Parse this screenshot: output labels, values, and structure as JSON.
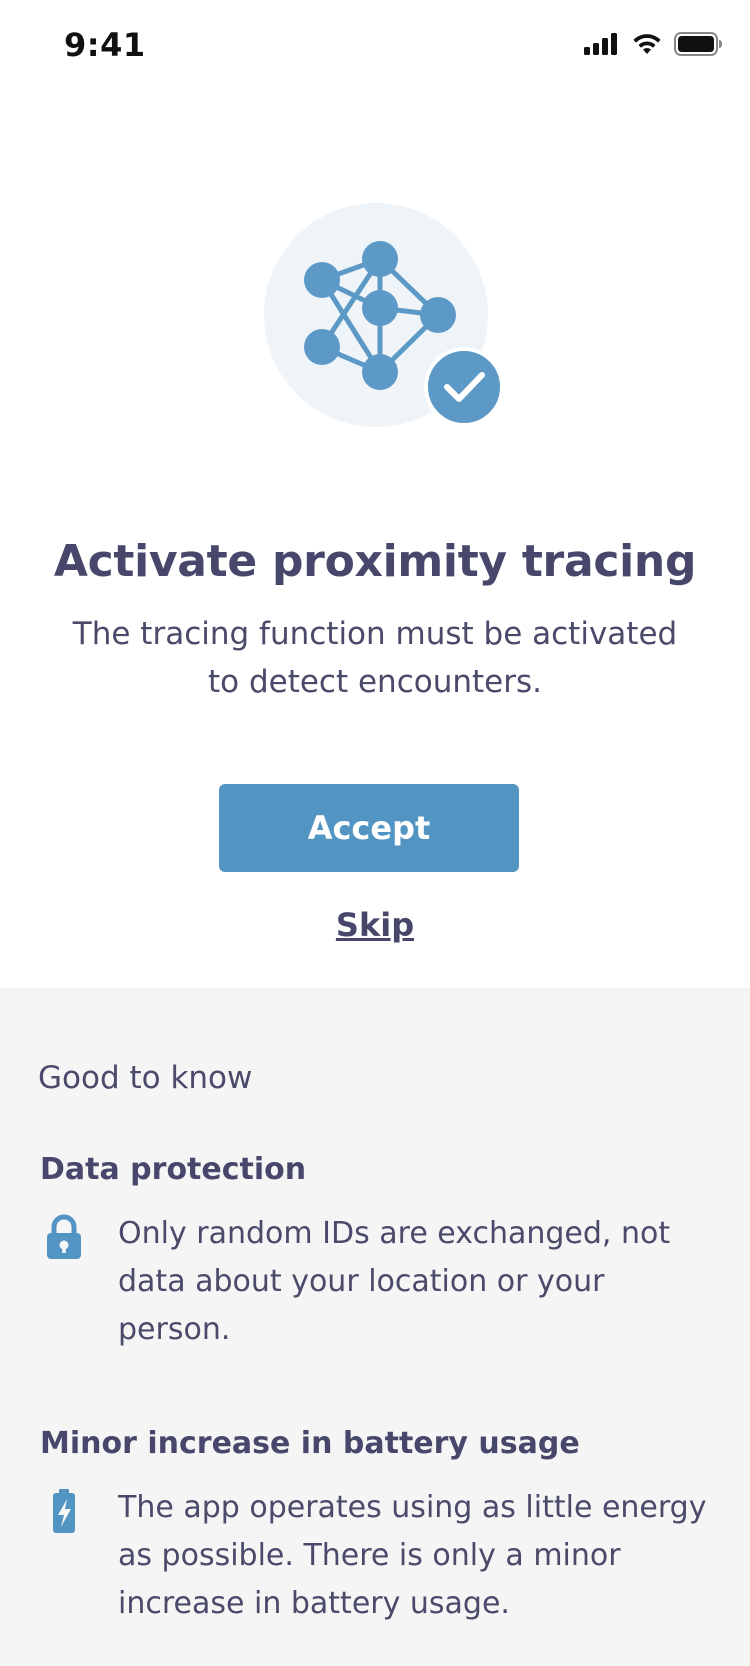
{
  "status_bar": {
    "time": "9:41",
    "icons": [
      "signal-icon",
      "wifi-icon",
      "battery-icon"
    ]
  },
  "hero": {
    "illustration": "network-check-illustration",
    "title": "Activate proximity tracing",
    "subtitle": "The tracing function must be activated to detect encounters.",
    "accept_label": "Accept",
    "skip_label": "Skip"
  },
  "info": {
    "heading": "Good to know",
    "items": [
      {
        "title": "Data protection",
        "icon": "lock-icon",
        "text": "Only random IDs are exchanged, not data about your location or your person."
      },
      {
        "title": "Minor increase in battery usage",
        "icon": "battery-charging-icon",
        "text": "The app operates using as little energy as possible. There is only a minor increase in battery usage."
      }
    ]
  },
  "colors": {
    "accent": "#5295c2",
    "text": "#47476b",
    "illustration_bg": "#eff4f8",
    "info_bg": "#f5f5f6"
  }
}
